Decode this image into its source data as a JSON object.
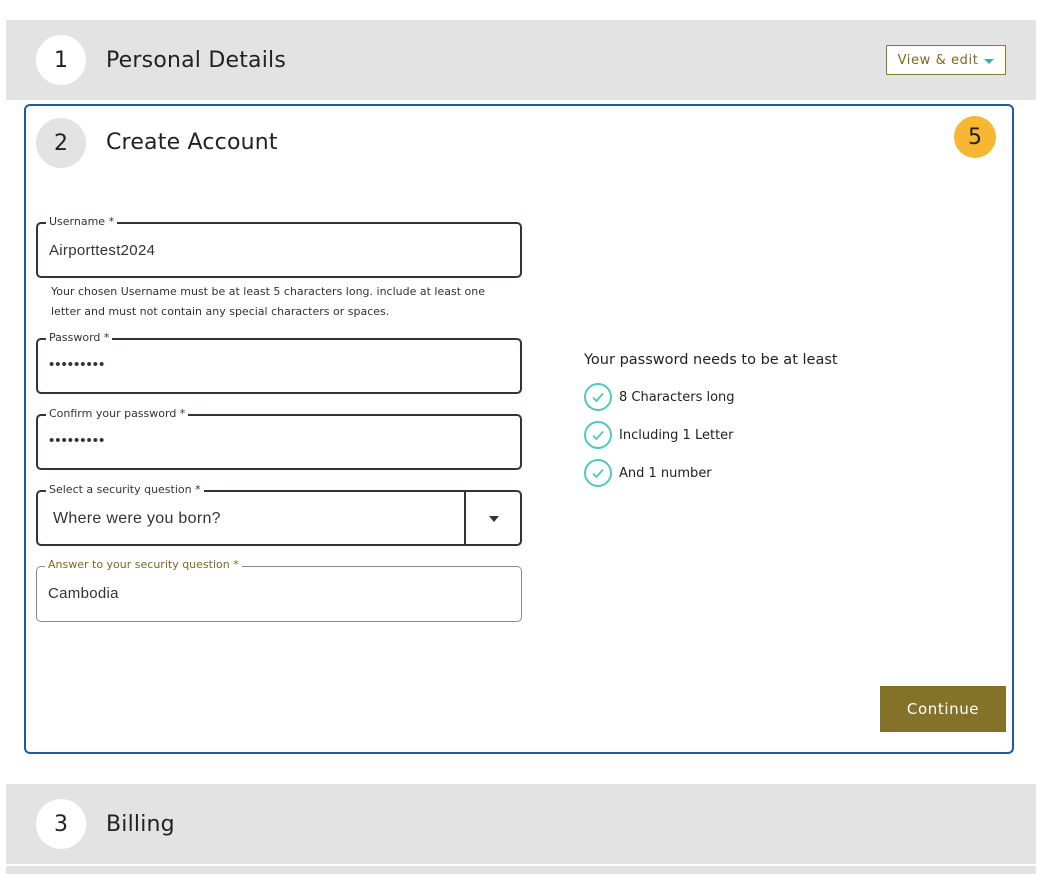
{
  "steps": {
    "personal": {
      "number": "1",
      "title": "Personal Details",
      "action_label": "View & edit"
    },
    "account": {
      "number": "2",
      "title": "Create Account",
      "badge": "5",
      "username": {
        "label": "Username *",
        "value": "Airporttest2024"
      },
      "username_hint": "Your chosen Username must be at least 5 characters long. include at least one letter and must not contain any special characters or spaces.",
      "password": {
        "label": "Password *",
        "value": "•••••••••"
      },
      "confirm_password": {
        "label": "Confirm your password *",
        "value": "•••••••••"
      },
      "security_question": {
        "label": "Select a security question *",
        "value": "Where were you born?"
      },
      "security_answer": {
        "label": "Answer to your security question *",
        "value": "Cambodia"
      },
      "password_rules": {
        "title": "Your password needs to be at least",
        "items": [
          "8 Characters long",
          "Including 1 Letter",
          "And 1 number"
        ]
      },
      "continue_label": "Continue"
    },
    "billing": {
      "number": "3",
      "title": "Billing"
    }
  },
  "colors": {
    "accent_gold": "#857229",
    "card_border": "#1f5aa6",
    "badge": "#f7b733",
    "check_teal": "#4ec9c0",
    "step_bar": "#e3e3e3"
  },
  "icons": [
    "caret-down-icon",
    "check-circle-icon",
    "select-arrow-icon"
  ]
}
